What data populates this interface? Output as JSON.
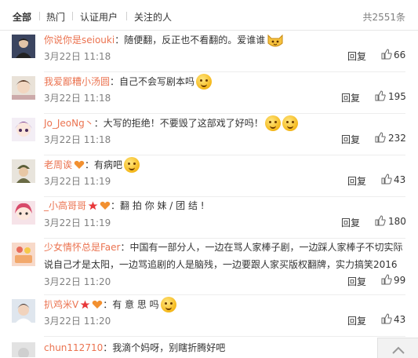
{
  "tabs": {
    "items": [
      "全部",
      "热门",
      "认证用户",
      "关注的人"
    ],
    "total": "共2551条"
  },
  "actions": {
    "reply": "回复"
  },
  "comments": [
    {
      "name": "你说你是seiouki",
      "text": "：随便翻，反正也不看翻的。爱谁谁",
      "time": "3月22日 11:18",
      "likes": "66"
    },
    {
      "name": "我爱鄙糟小汤圆",
      "text": "：自己不会写剧本吗",
      "time": "3月22日 11:18",
      "likes": "195"
    },
    {
      "name": "Jo_JeoNg丶",
      "text": "：大写的拒绝！不要毁了这部戏了好吗！",
      "time": "3月22日 11:18",
      "likes": "232"
    },
    {
      "name": "老周诶",
      "text": "：有病吧",
      "time": "3月22日 11:19",
      "likes": "43"
    },
    {
      "name": "_小高哥哥",
      "text": "：翻 拍 你 妹 / 团 结 !",
      "time": "3月22日 11:19",
      "likes": "180"
    },
    {
      "name": "少女情怀总是Faer",
      "text": "：中国有一部分人，一边在骂人家棒子剧，一边踩人家棒子不切实际",
      "text2": "说自己才是太阳，一边骂追剧的人是脑残，一边要跟人家买版权翻牌，实力搞笑2016",
      "time": "3月22日 11:20",
      "likes": "99"
    },
    {
      "name": "扒鸡米V",
      "text": "：有 意 思 吗",
      "time": "3月22日 11:20",
      "likes": "43"
    },
    {
      "name": "chun112710",
      "text": "：我滴个妈呀，别瞎折腾好吧"
    }
  ]
}
